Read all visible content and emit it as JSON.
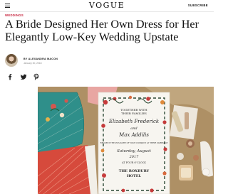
{
  "header": {
    "logo": "VOGUE",
    "subscribe_label": "SUBSCRIBE"
  },
  "article": {
    "category": "WEDDINGS",
    "headline": "A Bride Designed Her Own Dress for Her Elegantly Low-Key Wedding Upstate",
    "byline": "BY ALEXANDRA MACON",
    "date": "January 30, 2018"
  },
  "social": {
    "icons": [
      "facebook-icon",
      "twitter-icon",
      "pinterest-icon"
    ]
  },
  "hero": {
    "invitation_lines": [
      "TOGETHER WITH",
      "THEIR FAMILIES",
      "Elizabeth Frederick",
      "and",
      "Max Addilis",
      "REQUEST THE PLEASURE OF YOUR COMPANY AT THEIR MARRIAGE",
      "Saturday, August",
      "2017",
      "AT FOUR O'CLOCK",
      "THE ROXBURY",
      "HOTEL"
    ]
  },
  "colors": {
    "category": "#c6203a",
    "text": "#111111",
    "muted": "#888888"
  }
}
